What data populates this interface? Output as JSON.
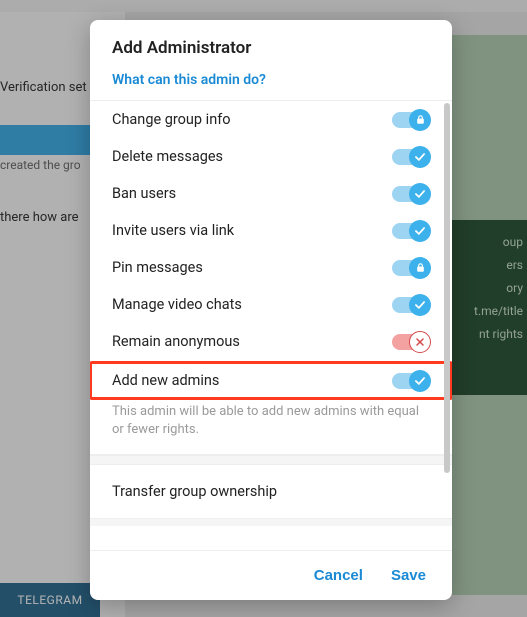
{
  "background": {
    "verification": "Verification set",
    "created": "created the gro",
    "there": "there how are",
    "telegram": "TELEGRAM",
    "right": {
      "oup": "oup",
      "ers": "ers",
      "ory": "ory",
      "link": "t.me/title",
      "rights": "nt rights"
    }
  },
  "modal": {
    "title": "Add Administrator",
    "subtitle": "What can this admin do?",
    "permissions": [
      {
        "key": "change_info",
        "label": "Change group info",
        "state": "on",
        "icon": "lock"
      },
      {
        "key": "delete_msgs",
        "label": "Delete messages",
        "state": "on",
        "icon": "check"
      },
      {
        "key": "ban_users",
        "label": "Ban users",
        "state": "on",
        "icon": "check"
      },
      {
        "key": "invite_link",
        "label": "Invite users via link",
        "state": "on",
        "icon": "check"
      },
      {
        "key": "pin_msgs",
        "label": "Pin messages",
        "state": "on",
        "icon": "lock"
      },
      {
        "key": "manage_vc",
        "label": "Manage video chats",
        "state": "on",
        "icon": "check"
      },
      {
        "key": "anonymous",
        "label": "Remain anonymous",
        "state": "off",
        "icon": "x"
      },
      {
        "key": "add_admins",
        "label": "Add new admins",
        "state": "on",
        "icon": "check",
        "highlighted": true
      }
    ],
    "hint": "This admin will be able to add new admins with equal or fewer rights.",
    "transfer": "Transfer group ownership",
    "cancel": "Cancel",
    "save": "Save"
  },
  "colors": {
    "accent": "#1a8ad5",
    "toggle_on": "#3cb1ec",
    "toggle_off": "#d34a4a",
    "highlight": "#ff3a1f"
  }
}
